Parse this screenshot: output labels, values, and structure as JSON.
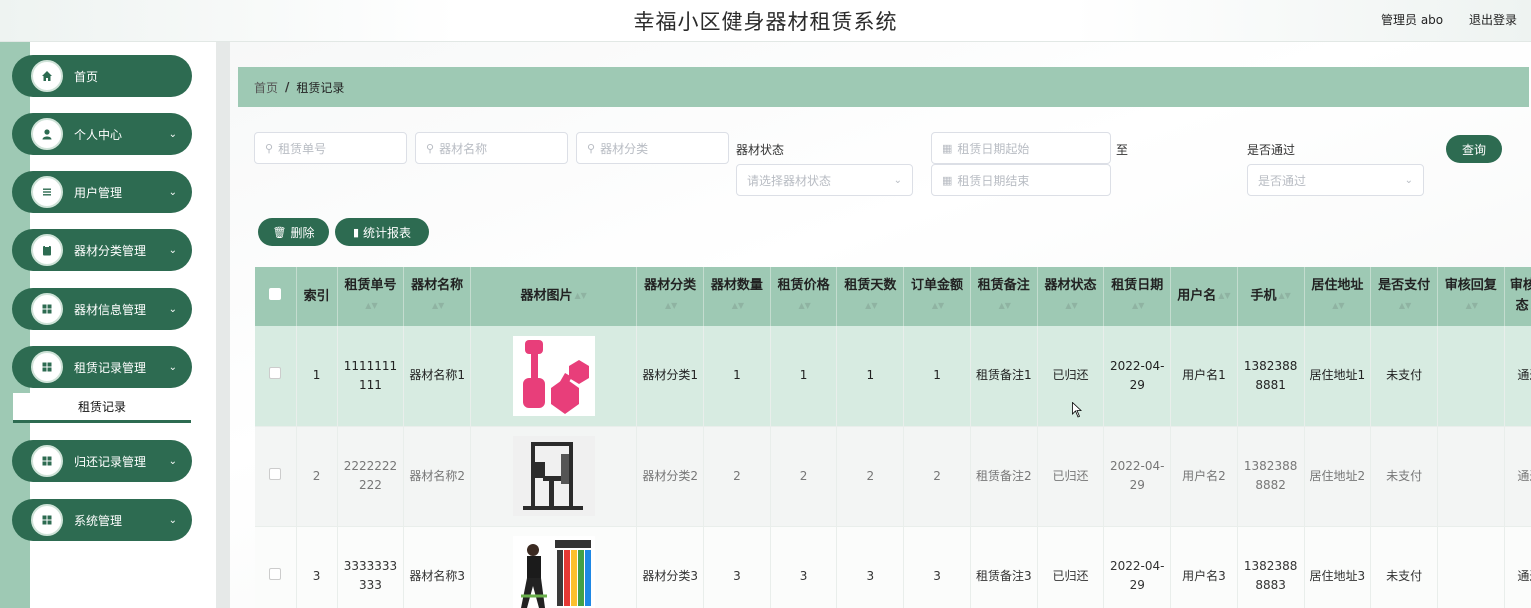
{
  "header": {
    "title": "幸福小区健身器材租赁系统",
    "user_label": "管理员 abo",
    "logout": "退出登录"
  },
  "sidebar": {
    "items": [
      {
        "label": "首页",
        "icon": "home-icon"
      },
      {
        "label": "个人中心",
        "icon": "user-icon"
      },
      {
        "label": "用户管理",
        "icon": "list-icon"
      },
      {
        "label": "器材分类管理",
        "icon": "clipboard-icon"
      },
      {
        "label": "器材信息管理",
        "icon": "grid-icon"
      },
      {
        "label": "租赁记录管理",
        "icon": "grid-icon"
      },
      {
        "label": "归还记录管理",
        "icon": "grid-icon"
      },
      {
        "label": "系统管理",
        "icon": "grid-icon"
      }
    ],
    "submenu_active": "租赁记录"
  },
  "breadcrumb": {
    "home": "首页",
    "separator": "/",
    "current": "租赁记录"
  },
  "search": {
    "rental_no_placeholder": "租赁单号",
    "equipment_name_placeholder": "器材名称",
    "category_placeholder": "器材分类",
    "status_label": "器材状态",
    "status_placeholder": "请选择器材状态",
    "date_start_placeholder": "租赁日期起始",
    "date_to": "至",
    "date_end_placeholder": "租赁日期结束",
    "passed_label": "是否通过",
    "passed_placeholder": "是否通过",
    "query_button": "查询"
  },
  "actions": {
    "delete": "删除",
    "report": "统计报表"
  },
  "table": {
    "headers": [
      "索引",
      "租赁单号",
      "器材名称",
      "器材图片",
      "器材分类",
      "器材数量",
      "租赁价格",
      "租赁天数",
      "订单金额",
      "租赁备注",
      "器材状态",
      "租赁日期",
      "用户名",
      "手机",
      "居住地址",
      "是否支付",
      "审核回复",
      "审核状态"
    ],
    "rows": [
      {
        "index": "1",
        "rental_no": "1111111111",
        "name": "器材名称1",
        "image": "dumbbell-image",
        "category": "器材分类1",
        "qty": "1",
        "price": "1",
        "days": "1",
        "amount": "1",
        "remark": "租赁备注1",
        "status": "已归还",
        "date": "2022-04-29",
        "username": "用户名1",
        "phone": "13823888881",
        "address": "居住地址1",
        "paid": "未支付",
        "reply": "",
        "audit": "通过"
      },
      {
        "index": "2",
        "rental_no": "2222222222",
        "name": "器材名称2",
        "image": "gym-machine-image",
        "category": "器材分类2",
        "qty": "2",
        "price": "2",
        "days": "2",
        "amount": "2",
        "remark": "租赁备注2",
        "status": "已归还",
        "date": "2022-04-29",
        "username": "用户名2",
        "phone": "13823888882",
        "address": "居住地址2",
        "paid": "未支付",
        "reply": "",
        "audit": "通过"
      },
      {
        "index": "3",
        "rental_no": "3333333333",
        "name": "器材名称3",
        "image": "resistance-bands-image",
        "category": "器材分类3",
        "qty": "3",
        "price": "3",
        "days": "3",
        "amount": "3",
        "remark": "租赁备注3",
        "status": "已归还",
        "date": "2022-04-29",
        "username": "用户名3",
        "phone": "13823888883",
        "address": "居住地址3",
        "paid": "未支付",
        "reply": "",
        "audit": "通过"
      }
    ]
  },
  "colors": {
    "primary": "#2d6b51",
    "accent": "#9ec9b4",
    "row_highlight": "#d7ebe1"
  }
}
